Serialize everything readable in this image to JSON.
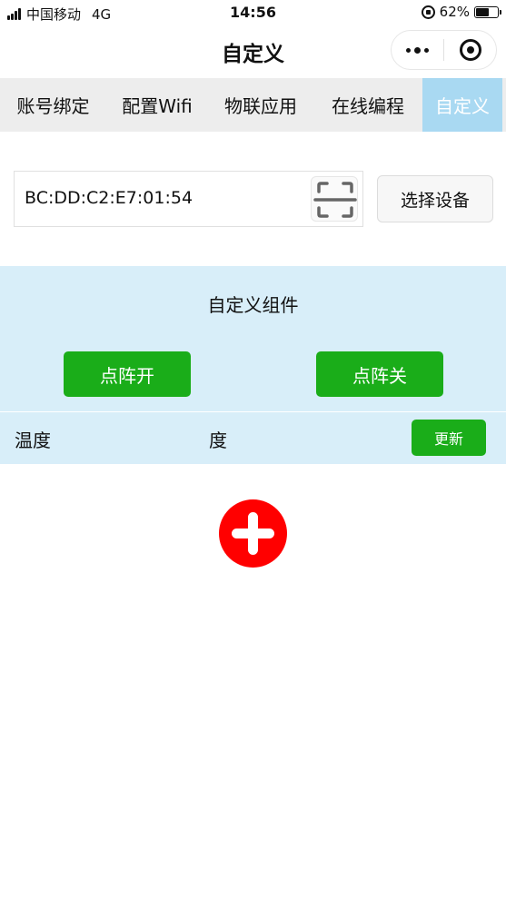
{
  "status_bar": {
    "carrier": "中国移动",
    "network": "4G",
    "time": "14:56",
    "battery": "62%",
    "battery_level": 0.62
  },
  "nav": {
    "title": "自定义"
  },
  "tabs": [
    {
      "label": "账号绑定",
      "active": false
    },
    {
      "label": "配置Wifi",
      "active": false
    },
    {
      "label": "物联应用",
      "active": false
    },
    {
      "label": "在线编程",
      "active": false
    },
    {
      "label": "自定义",
      "active": true
    }
  ],
  "device": {
    "mac_value": "BC:DD:C2:E7:01:54",
    "select_button": "选择设备"
  },
  "custom_panel": {
    "title": "自定义组件",
    "matrix_on_button": "点阵开",
    "matrix_off_button": "点阵关",
    "temperature_label": "温度",
    "temperature_unit": "度",
    "refresh_button": "更新"
  },
  "colors": {
    "accent_green": "#1aad19",
    "panel_blue": "#d8eef9",
    "active_tab": "#a9d9f2",
    "add_red": "#ff0000"
  }
}
